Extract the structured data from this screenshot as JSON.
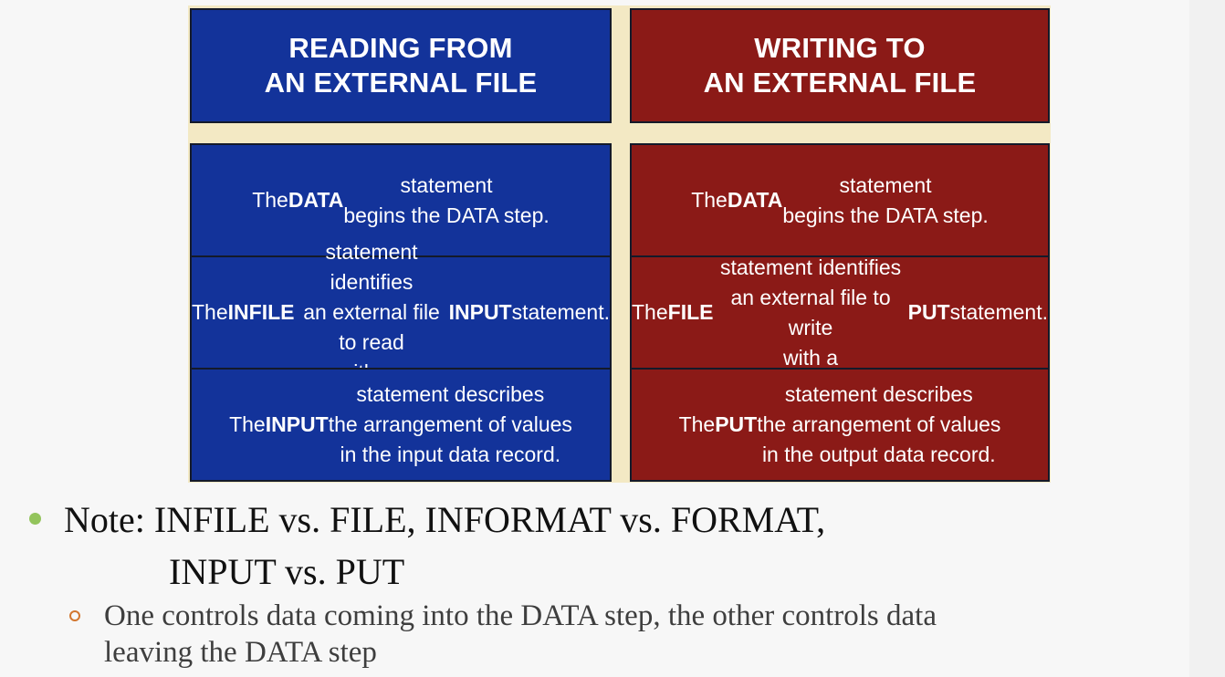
{
  "figure": {
    "left_header": "READING FROM\nAN EXTERNAL FILE",
    "right_header": "WRITING TO\nAN EXTERNAL FILE",
    "left_rows": [
      "The DATA statement\nbegins the DATA step.",
      "The INFILE statement identifies\nan external file to read\nwith an INPUT statement.",
      "The INPUT statement describes\nthe arrangement of values\nin the input data record."
    ],
    "right_rows": [
      "The DATA statement\nbegins the DATA step.",
      "The FILE statement identifies\nan external file to write\nwith a PUT statement.",
      "The PUT statement describes\nthe arrangement of values\nin the output data record."
    ],
    "colors": {
      "left": "#13339a",
      "right": "#8b1a17",
      "background": "#f3e9c4"
    }
  },
  "bullets": {
    "note_line1": "Note: INFILE vs. FILE, INFORMAT vs. FORMAT,",
    "note_line2": "INPUT vs. PUT",
    "sub_line1": "One controls data coming into the DATA step, the other controls data",
    "sub_line2": "leaving the DATA step",
    "bullet_color": "#93c45c",
    "sub_bullet_color": "#d2762f"
  }
}
